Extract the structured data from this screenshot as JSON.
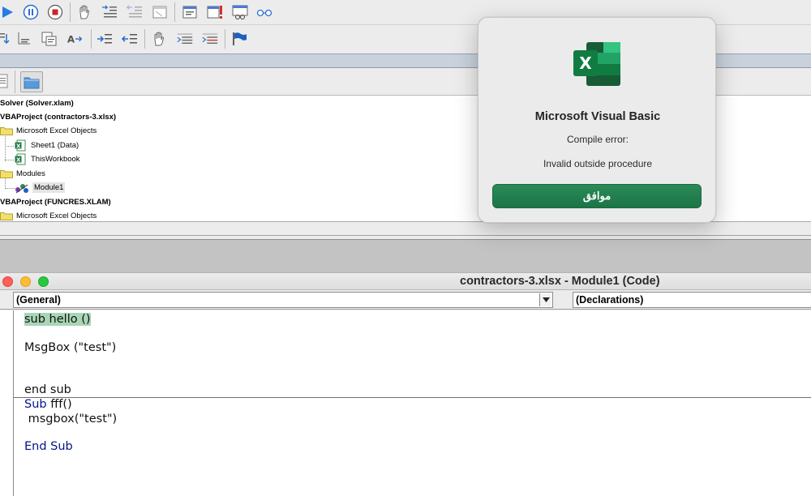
{
  "project_tree": [
    {
      "label": "Solver (Solver.xlam)",
      "kind": "project"
    },
    {
      "label": "VBAProject (contractors-3.xlsx)",
      "kind": "project"
    },
    {
      "label": "Microsoft Excel Objects",
      "kind": "folder"
    },
    {
      "label": "Sheet1 (Data)",
      "kind": "sheet"
    },
    {
      "label": "ThisWorkbook",
      "kind": "workbook"
    },
    {
      "label": "Modules",
      "kind": "folder"
    },
    {
      "label": "Module1",
      "kind": "module",
      "selected": true
    },
    {
      "label": "VBAProject (FUNCRES.XLAM)",
      "kind": "project"
    },
    {
      "label": "Microsoft Excel Objects",
      "kind": "folder"
    }
  ],
  "code_window": {
    "title": "contractors-3.xlsx - Module1 (Code)",
    "object_combo": "(General)",
    "procedure_combo": "(Declarations)",
    "lines": [
      "sub hello ()",
      "MsgBox (\"test\")",
      "end sub",
      "Sub",
      " fff()",
      " msgbox(\"test\")",
      "End Sub"
    ]
  },
  "dialog": {
    "title": "Microsoft Visual Basic",
    "message_line1": "Compile error:",
    "message_line2": "Invalid outside procedure",
    "ok_label": "موافق",
    "app_icon_letter": "X"
  },
  "colors": {
    "ok_button": "#1f7a4a",
    "keyword": "#00148c",
    "highlight": "#a8d6b6",
    "excel_green": "#107c41"
  }
}
